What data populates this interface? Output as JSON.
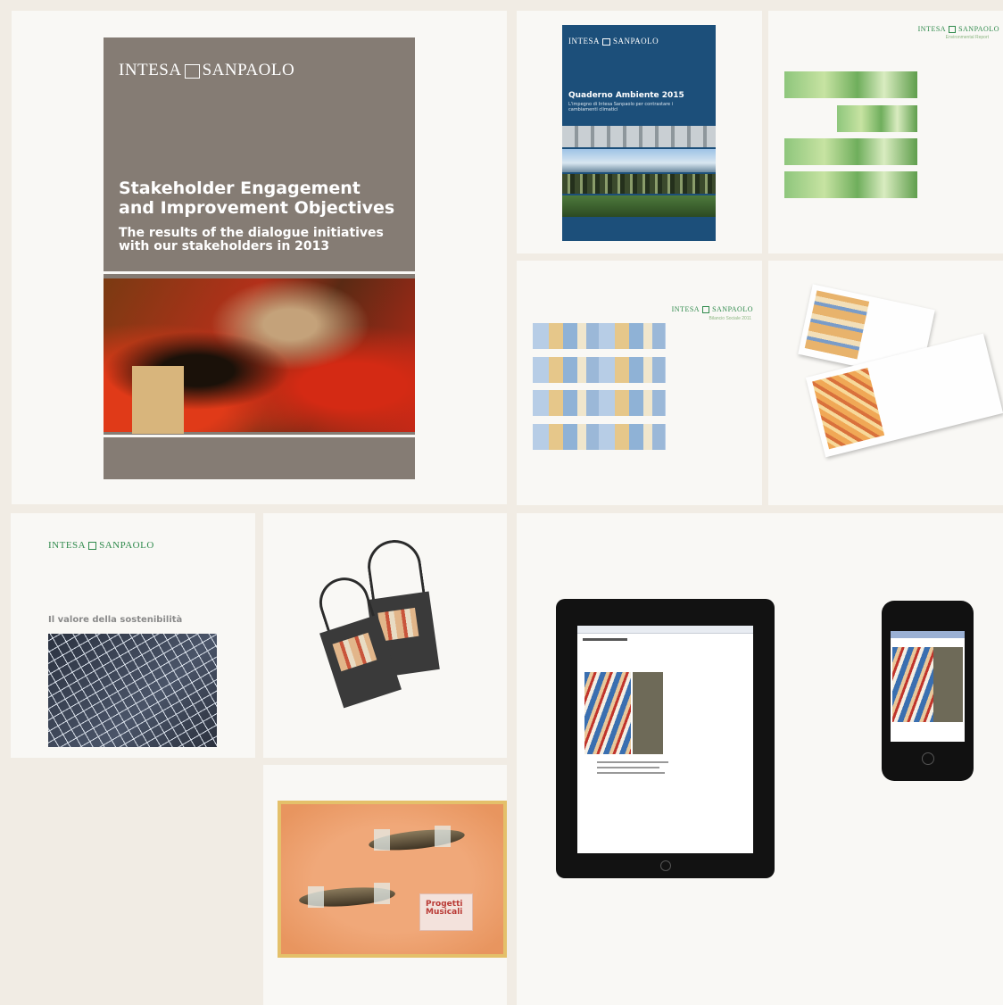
{
  "brand": "INTESA SANPAOLO",
  "brand_left": "INTESA",
  "brand_right": "SANPAOLO",
  "tile1": {
    "title": "Stakeholder Engagement and Improvement Objectives",
    "subtitle": "The results of the dialogue initiatives with our stakeholders in 2013"
  },
  "tile2": {
    "title": "Quaderno Ambiente 2015",
    "subtitle": "L'impegno di Intesa Sanpaolo per contrastare i cambiamenti climatici"
  },
  "tile3": {
    "subtitle": "Environmental Report"
  },
  "tile4": {
    "subtitle": "Bilancio Sociale 2011"
  },
  "tile6": {
    "title": "Il valore della sostenibilità"
  },
  "tile8": {
    "stamp_text": "Progetti Musicali"
  },
  "colors": {
    "page_bg": "#f1ece4",
    "tile_bg": "#f9f8f5",
    "brand_green": "#2f8a4c",
    "cover_brown": "#857c74",
    "cover_blue": "#1c4f7a"
  }
}
